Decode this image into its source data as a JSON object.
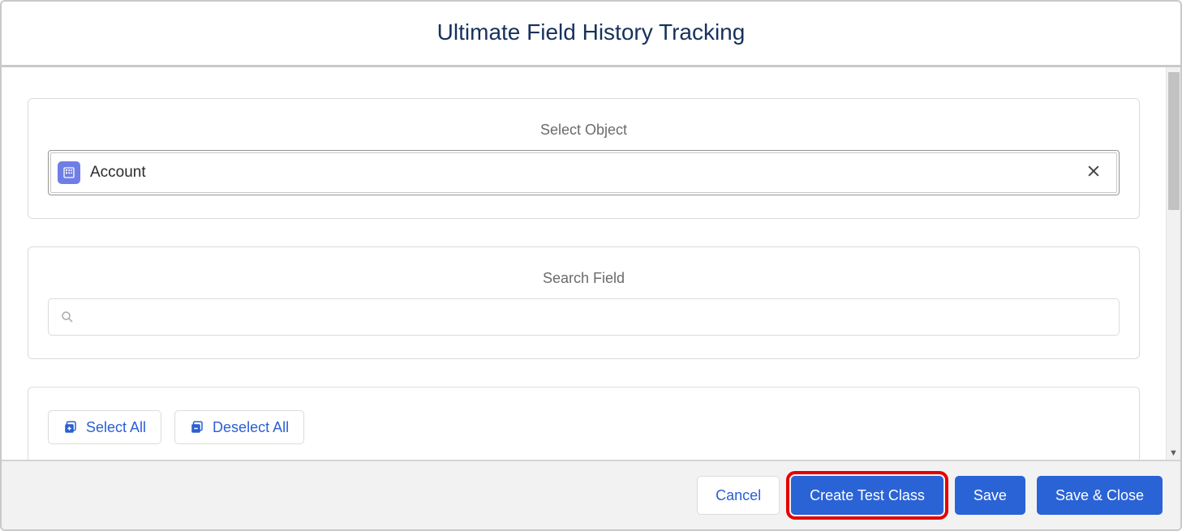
{
  "modal": {
    "title": "Ultimate Field History Tracking"
  },
  "selectObject": {
    "label": "Select Object",
    "value": "Account"
  },
  "searchField": {
    "label": "Search Field",
    "placeholder": ""
  },
  "actions": {
    "selectAll": "Select All",
    "deselectAll": "Deselect All"
  },
  "footer": {
    "cancel": "Cancel",
    "createTestClass": "Create Test Class",
    "save": "Save",
    "saveAndClose": "Save & Close"
  }
}
